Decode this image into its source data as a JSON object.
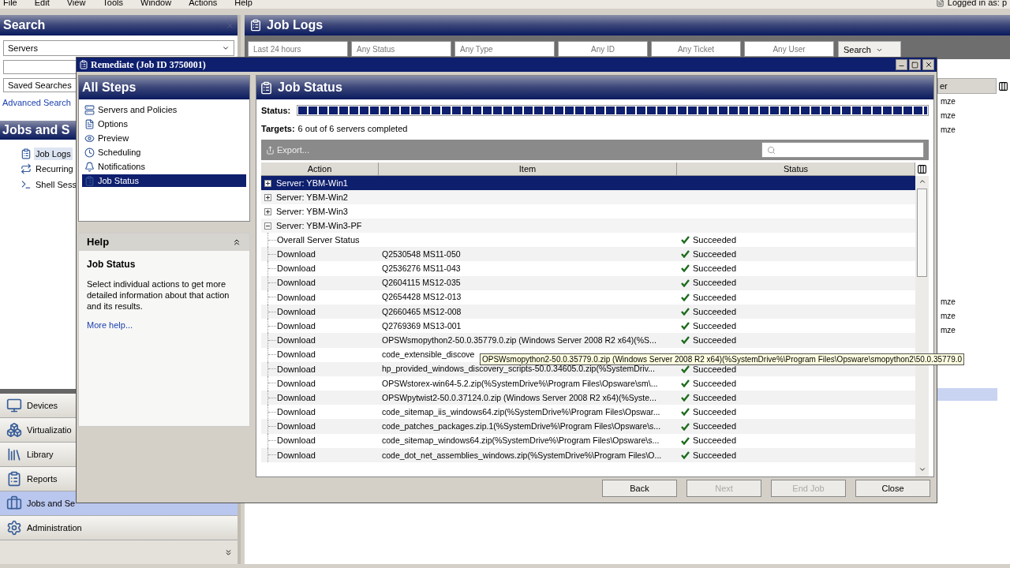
{
  "menu": [
    "File",
    "Edit",
    "View",
    "Tools",
    "Window",
    "Actions",
    "Help"
  ],
  "login": "Logged in as: p",
  "search_panel": {
    "title": "Search",
    "scope": "Servers",
    "saved": "Saved Searches",
    "advanced_link": "Advanced Search"
  },
  "jobs_panel": {
    "title": "Jobs and S",
    "tree": [
      {
        "label": "Job Logs",
        "selected": true
      },
      {
        "label": "Recurring",
        "selected": false
      },
      {
        "label": "Shell Sess",
        "selected": false
      }
    ]
  },
  "nav": [
    {
      "label": "Devices",
      "selected": false
    },
    {
      "label": "Virtualizatio",
      "selected": false
    },
    {
      "label": "Library",
      "selected": false
    },
    {
      "label": "Reports",
      "selected": false
    },
    {
      "label": "Jobs and Se",
      "selected": true
    },
    {
      "label": "Administration",
      "selected": false
    }
  ],
  "job_logs": {
    "title": "Job Logs",
    "filters": [
      "Last 24 hours",
      "Any Status",
      "Any Type",
      "Any ID",
      "Any Ticket",
      "Any User"
    ],
    "search_button": "Search",
    "column": "er",
    "cells": [
      "mze",
      "mze",
      "mze",
      "mze",
      "mze",
      "mze"
    ]
  },
  "dialog": {
    "title": "Remediate (Job ID 3750001)",
    "steps_title": "All Steps",
    "steps": [
      {
        "label": "Servers and Policies",
        "selected": false
      },
      {
        "label": "Options",
        "selected": false
      },
      {
        "label": "Preview",
        "selected": false
      },
      {
        "label": "Scheduling",
        "selected": false
      },
      {
        "label": "Notifications",
        "selected": false
      },
      {
        "label": "Job Status",
        "selected": true
      }
    ],
    "help": {
      "title": "Help",
      "topic": "Job Status",
      "text": "Select individual actions to get more detailed information about that action and its results.",
      "link": "More help..."
    },
    "status": {
      "title": "Job Status",
      "status_label": "Status:",
      "level": 1,
      "targets_label": "Targets:",
      "targets": "6 out of 6 servers completed",
      "export": "Export...",
      "columns": [
        "Action",
        "Item",
        "Status"
      ],
      "servers": [
        {
          "label": "Server: YBM-Win1",
          "expanded": false,
          "selected": true
        },
        {
          "label": "Server: YBM-Win2",
          "expanded": false,
          "selected": false
        },
        {
          "label": "Server: YBM-Win3",
          "expanded": false,
          "selected": false
        },
        {
          "label": "Server: YBM-Win3-PF",
          "expanded": true,
          "selected": false,
          "children": [
            {
              "action": "Overall Server Status",
              "status": "Succeeded"
            },
            {
              "action": "Download",
              "item": "Q2530548 MS11-050",
              "status": "Succeeded"
            },
            {
              "action": "Download",
              "item": "Q2536276 MS11-043",
              "status": "Succeeded"
            },
            {
              "action": "Download",
              "item": "Q2604115 MS12-035",
              "status": "Succeeded"
            },
            {
              "action": "Download",
              "item": "Q2654428 MS12-013",
              "status": "Succeeded"
            },
            {
              "action": "Download",
              "item": "Q2660465 MS12-008",
              "status": "Succeeded"
            },
            {
              "action": "Download",
              "item": "Q2769369 MS13-001",
              "status": "Succeeded"
            },
            {
              "action": "Download",
              "item": "OPSWsmopython2-50.0.35779.0.zip (Windows Server 2008 R2 x64)(%S...",
              "status": "Succeeded"
            },
            {
              "action": "Download",
              "item": "code_extensible_discove"
            },
            {
              "action": "Download",
              "item": "hp_provided_windows_discovery_scripts-50.0.34605.0.zip(%SystemDriv...",
              "status": "Succeeded"
            },
            {
              "action": "Download",
              "item": "OPSWstorex-win64-5.2.zip(%SystemDrive%\\Program Files\\Opsware\\sm\\...",
              "status": "Succeeded"
            },
            {
              "action": "Download",
              "item": "OPSWpytwist2-50.0.37124.0.zip (Windows Server 2008 R2 x64)(%Syste...",
              "status": "Succeeded"
            },
            {
              "action": "Download",
              "item": "code_sitemap_iis_windows64.zip(%SystemDrive%\\Program Files\\Opswar...",
              "status": "Succeeded"
            },
            {
              "action": "Download",
              "item": "code_patches_packages.zip.1(%SystemDrive%\\Program Files\\Opsware\\s...",
              "status": "Succeeded"
            },
            {
              "action": "Download",
              "item": "code_sitemap_windows64.zip(%SystemDrive%\\Program Files\\Opsware\\s...",
              "status": "Succeeded"
            },
            {
              "action": "Download",
              "item": "code_dot_net_assemblies_windows.zip(%SystemDrive%\\Program Files\\O...",
              "status": "Succeeded"
            }
          ]
        }
      ],
      "tooltip": "OPSWsmopython2-50.0.35779.0.zip (Windows Server 2008 R2 x64)(%SystemDrive%\\Program Files\\Opsware\\smopython2\\50.0.35779.0"
    },
    "buttons": [
      {
        "label": "Back",
        "disabled": false
      },
      {
        "label": "Next",
        "disabled": true
      },
      {
        "label": "End Job",
        "disabled": true
      },
      {
        "label": "Close",
        "disabled": false
      }
    ]
  }
}
